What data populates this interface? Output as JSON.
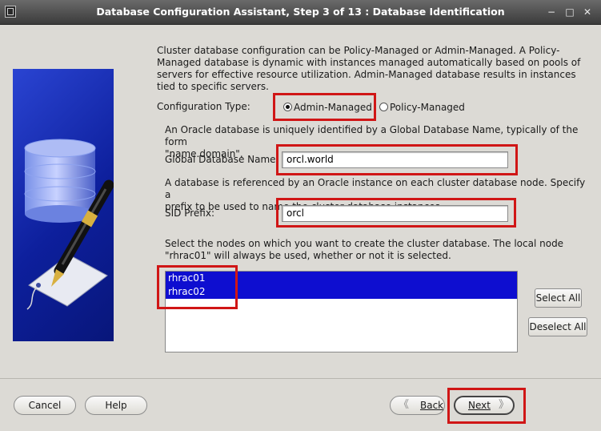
{
  "window": {
    "title": "Database Configuration Assistant, Step 3 of 13 : Database Identification",
    "controls": {
      "minimize": "−",
      "maximize": "□",
      "close": "✕"
    }
  },
  "intro": "Cluster database configuration can be Policy-Managed or Admin-Managed. A Policy-\nManaged database is dynamic with instances managed automatically based on pools of\nservers for effective resource utilization. Admin-Managed database results in instances\ntied to specific servers.",
  "config_type": {
    "label": "Configuration Type:",
    "options": [
      {
        "label": "Admin-Managed",
        "selected": true
      },
      {
        "label": "Policy-Managed",
        "selected": false
      }
    ]
  },
  "gdn": {
    "desc": "An Oracle database is uniquely identified by a Global Database Name, typically of the form\n\"name.domain\".",
    "label": "Global Database Name:",
    "value": "orcl.world"
  },
  "sid": {
    "desc": "A database is referenced by an Oracle instance on each cluster database node. Specify a\nprefix to be used to name the cluster database instances.",
    "label": "SID Prefix:",
    "value": "orcl"
  },
  "nodes": {
    "desc": "Select the nodes on which you want to create the cluster database. The local node\n\"rhrac01\" will always be used, whether or not it is selected.",
    "items": [
      {
        "label": "rhrac01",
        "selected": true
      },
      {
        "label": "rhrac02",
        "selected": true
      }
    ],
    "select_all": "Select All",
    "deselect_all": "Deselect All"
  },
  "footer": {
    "cancel": "Cancel",
    "help": "Help",
    "back": "Back",
    "next": "Next"
  },
  "colors": {
    "annotation": "#d01616",
    "selection": "#0e0ed0",
    "brand_panel": "#1a2fb8"
  }
}
